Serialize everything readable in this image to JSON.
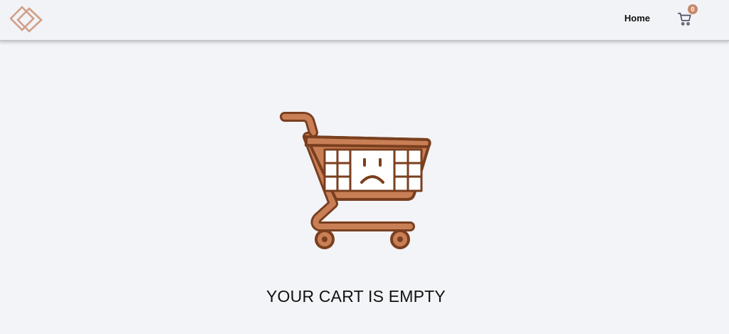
{
  "header": {
    "logo_icon": "diamond-logo-icon",
    "nav": {
      "home_label": "Home"
    },
    "cart": {
      "icon": "shopping-cart-icon",
      "count": "0"
    }
  },
  "main": {
    "illustration_icon": "sad-shopping-cart-icon",
    "message": "YOUR CART IS EMPTY"
  },
  "colors": {
    "accent": "#c7896a",
    "cart_fill": "#c97f55",
    "cart_stroke": "#7a3f1f",
    "background": "#f2f4f8",
    "nav_icon": "#4a5263"
  }
}
